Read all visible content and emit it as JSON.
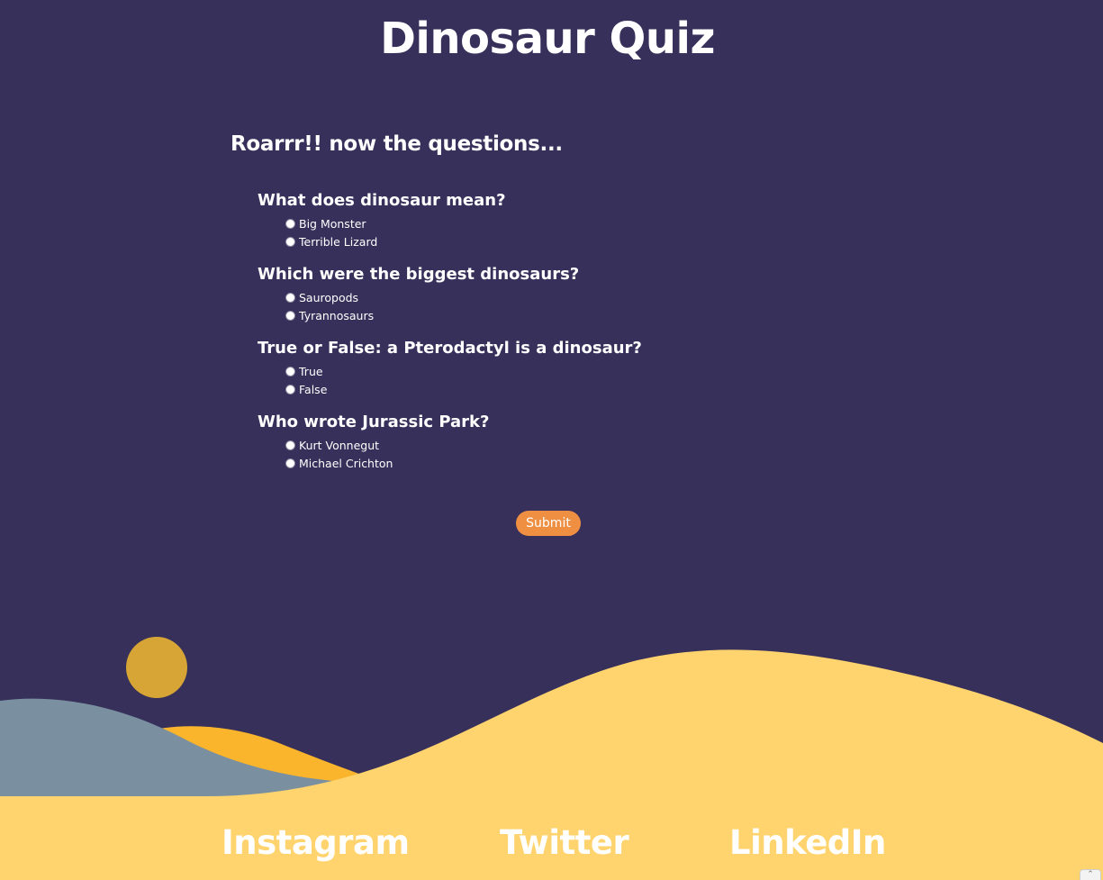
{
  "header": {
    "title": "Dinosaur Quiz"
  },
  "quiz": {
    "intro": "Roarrr!! now the questions...",
    "questions": [
      {
        "text": "What does dinosaur mean?",
        "options": [
          "Big Monster",
          "Terrible Lizard"
        ]
      },
      {
        "text": "Which were the biggest dinosaurs?",
        "options": [
          "Sauropods",
          "Tyrannosaurs"
        ]
      },
      {
        "text": "True or False: a Pterodactyl is a dinosaur?",
        "options": [
          "True",
          "False"
        ]
      },
      {
        "text": "Who wrote Jurassic Park?",
        "options": [
          "Kurt Vonnegut",
          "Michael Crichton"
        ]
      }
    ],
    "submit_label": "Submit"
  },
  "footer": {
    "links": [
      "Instagram",
      "Twitter",
      "LinkedIn"
    ]
  },
  "colors": {
    "background": "#36305a",
    "sun": "#d6a535",
    "hill_back": "#7a8fa0",
    "hill_orange": "#fbb52c",
    "sand": "#ffd36e",
    "button": "#ef8f42"
  },
  "icons": {
    "scroll_up": "chevron-up-icon"
  }
}
